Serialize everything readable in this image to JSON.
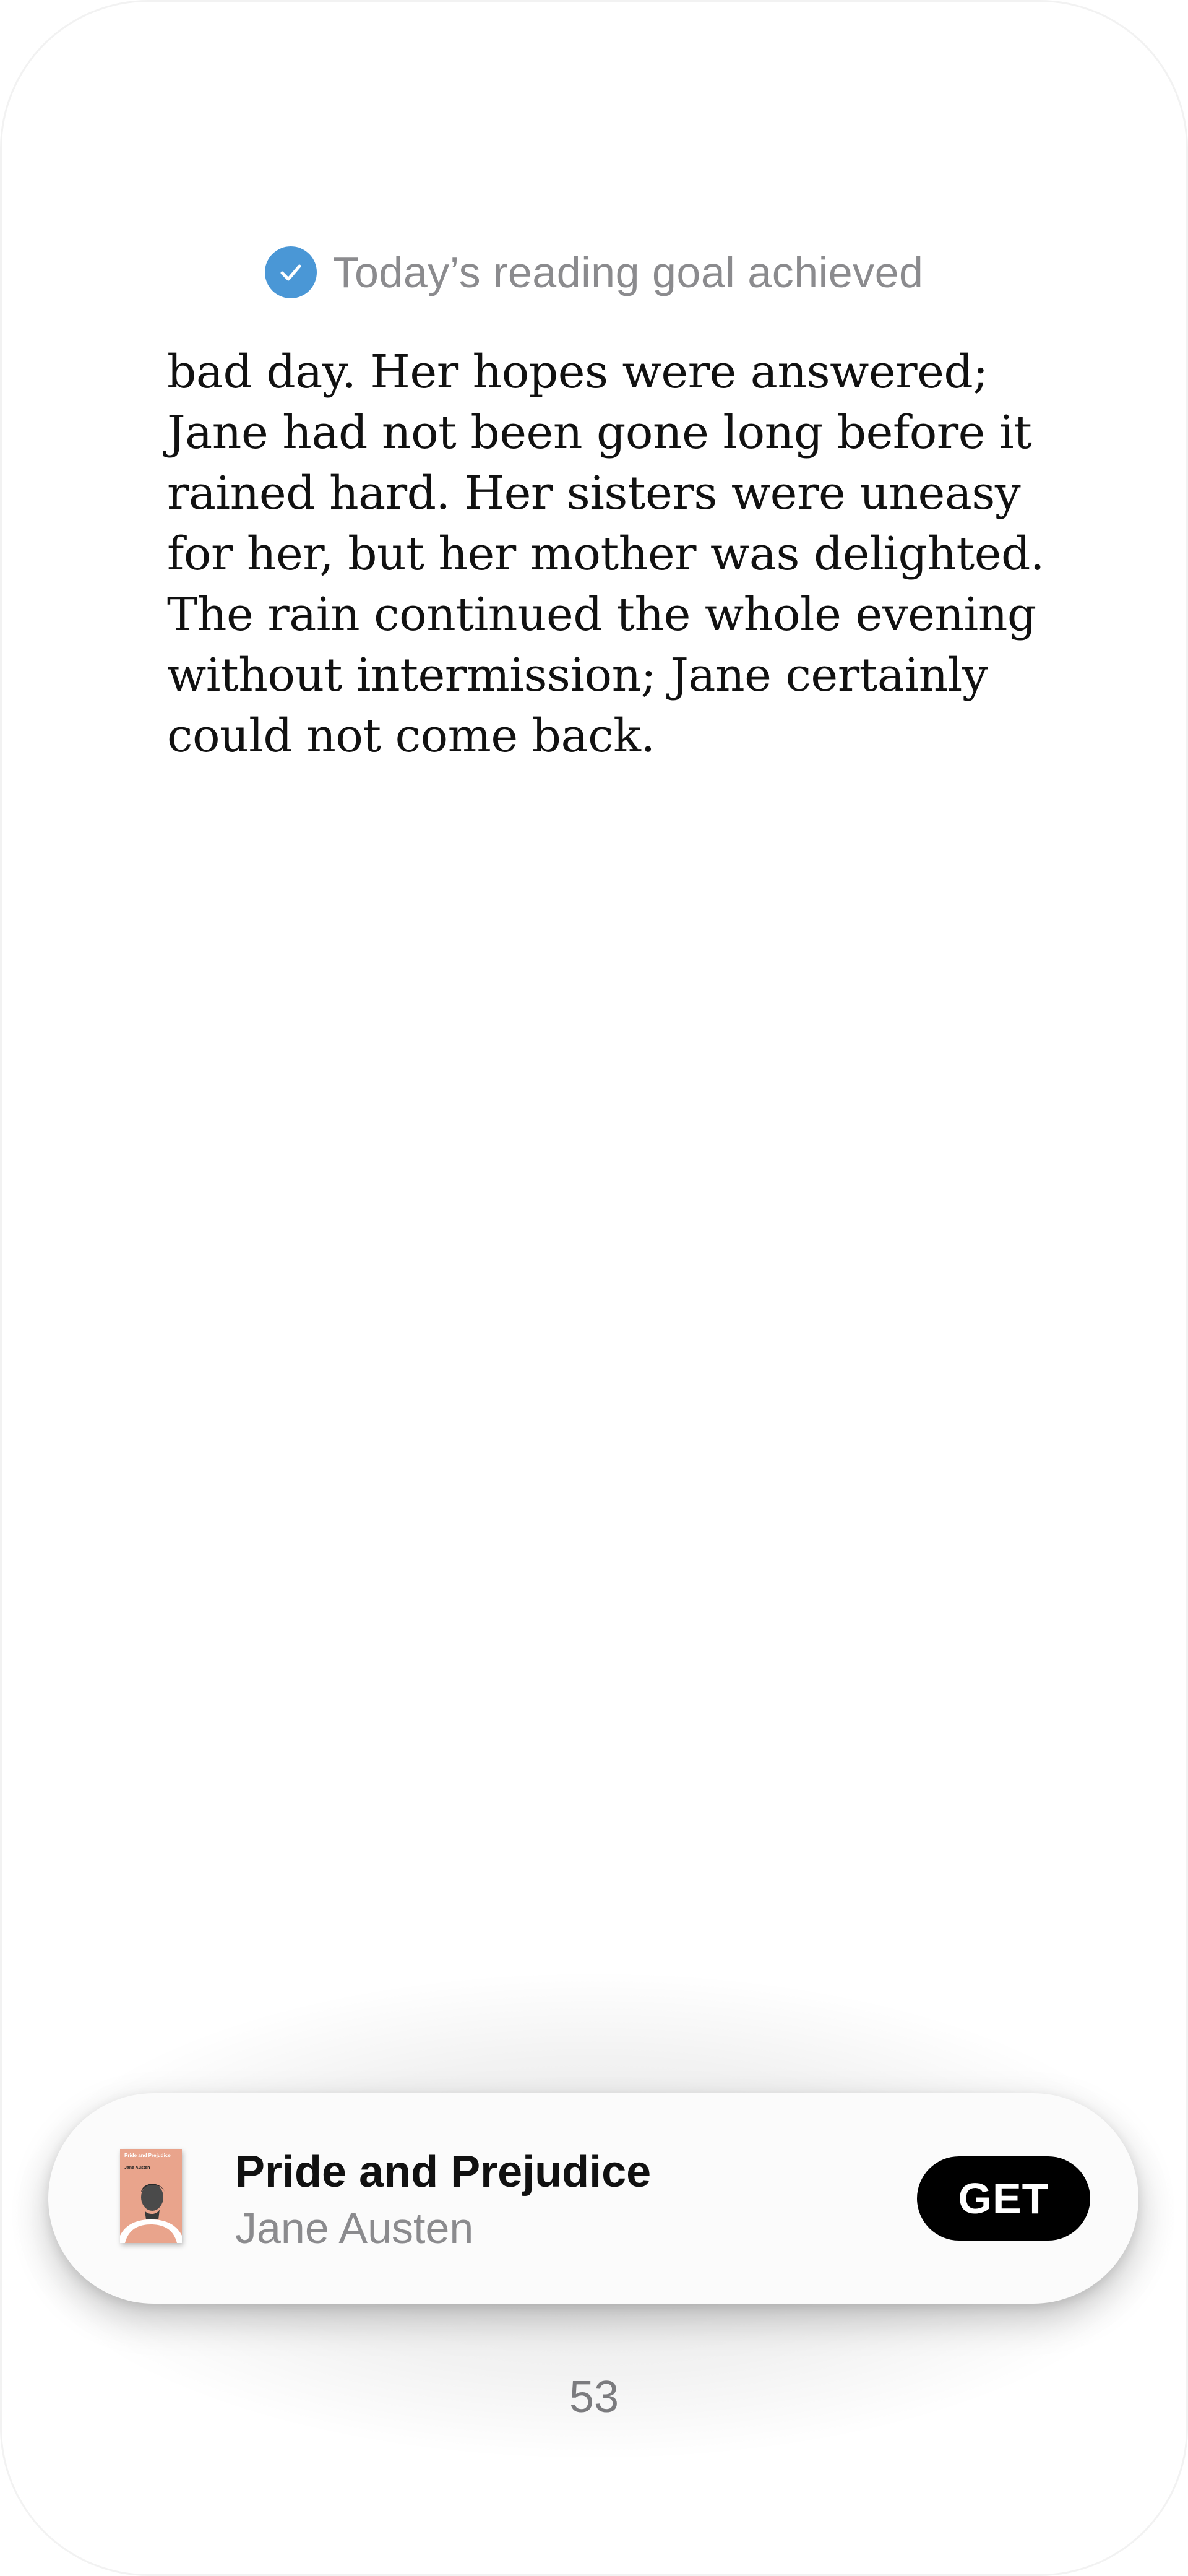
{
  "reading_goal": {
    "text": "Today’s reading goal achieved",
    "icon": "checkmark-circle-icon",
    "icon_color": "#4a97d6"
  },
  "book_text": {
    "body": "bad day. Her hopes were answered;\nJane had not been gone long before it\nrained hard. Her sisters were uneasy\nfor her, but her mother was delighted.\nThe rain continued the whole evening\nwithout intermission; Jane certainly\ncould not come back."
  },
  "book_card": {
    "title": "Pride and Prejudice",
    "author": "Jane Austen",
    "button_label": "GET",
    "cover": {
      "title": "Pride and Prejudice",
      "author": "Jane Austen",
      "color": "#e9a48c"
    }
  },
  "page": {
    "number": "53"
  }
}
